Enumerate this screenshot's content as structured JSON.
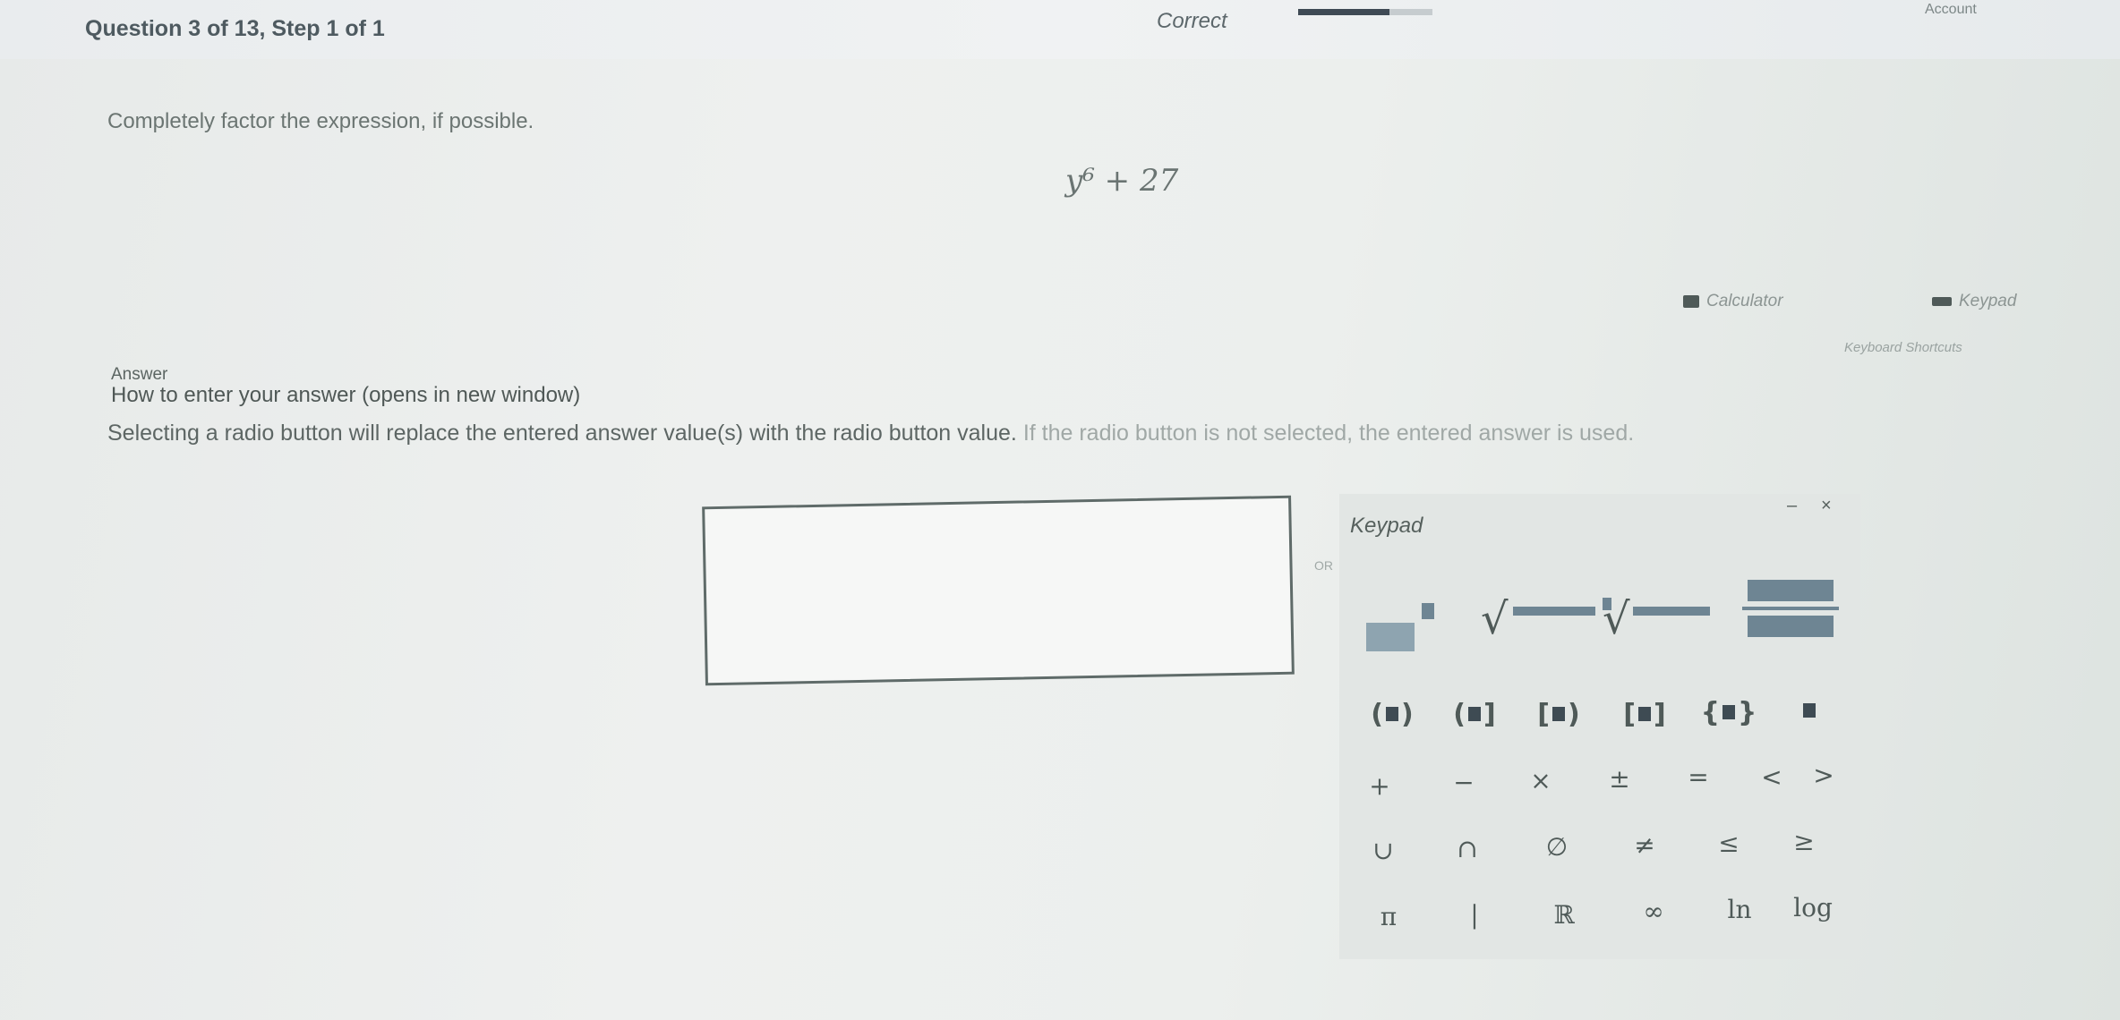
{
  "header": {
    "question_title": "Question 3 of 13, Step 1 of 1",
    "status": "Correct",
    "progress_fraction": 0.68,
    "top_right_text": "Account"
  },
  "question": {
    "prompt": "Completely factor the expression, if possible.",
    "expression": "y⁶ + 27"
  },
  "tools": {
    "calculator_label": "Calculator",
    "keypad_label": "Keypad",
    "keyboard_shortcuts_label": "Keyboard Shortcuts"
  },
  "answer": {
    "label": "Answer",
    "how_to_link": "How to enter your answer (opens in new window)",
    "instruction_main": "Selecting a radio button will replace the entered answer value(s) with the radio button value.",
    "instruction_faded": " If the radio button is not selected, the entered answer is used.",
    "input_value": "",
    "or_label": "OR"
  },
  "keypad": {
    "title": "Keypad",
    "minimize_glyph": "–",
    "close_glyph": "×",
    "row_parens": [
      "(■)",
      "(■]",
      "[■)",
      "[■]",
      "{■}",
      "■"
    ],
    "row_ops": [
      "+",
      "−",
      "×",
      "±",
      "=",
      "<",
      ">"
    ],
    "row_sets": [
      "∪",
      "∩",
      "∅",
      "≠",
      "≤",
      "≥"
    ],
    "row_consts": [
      "π",
      "|",
      "ℝ",
      "∞",
      "ln",
      "log"
    ]
  },
  "colors": {
    "accent_slate": "#6e8593",
    "text_dark": "#4f5a58",
    "progress_fill": "#3f4a55"
  }
}
